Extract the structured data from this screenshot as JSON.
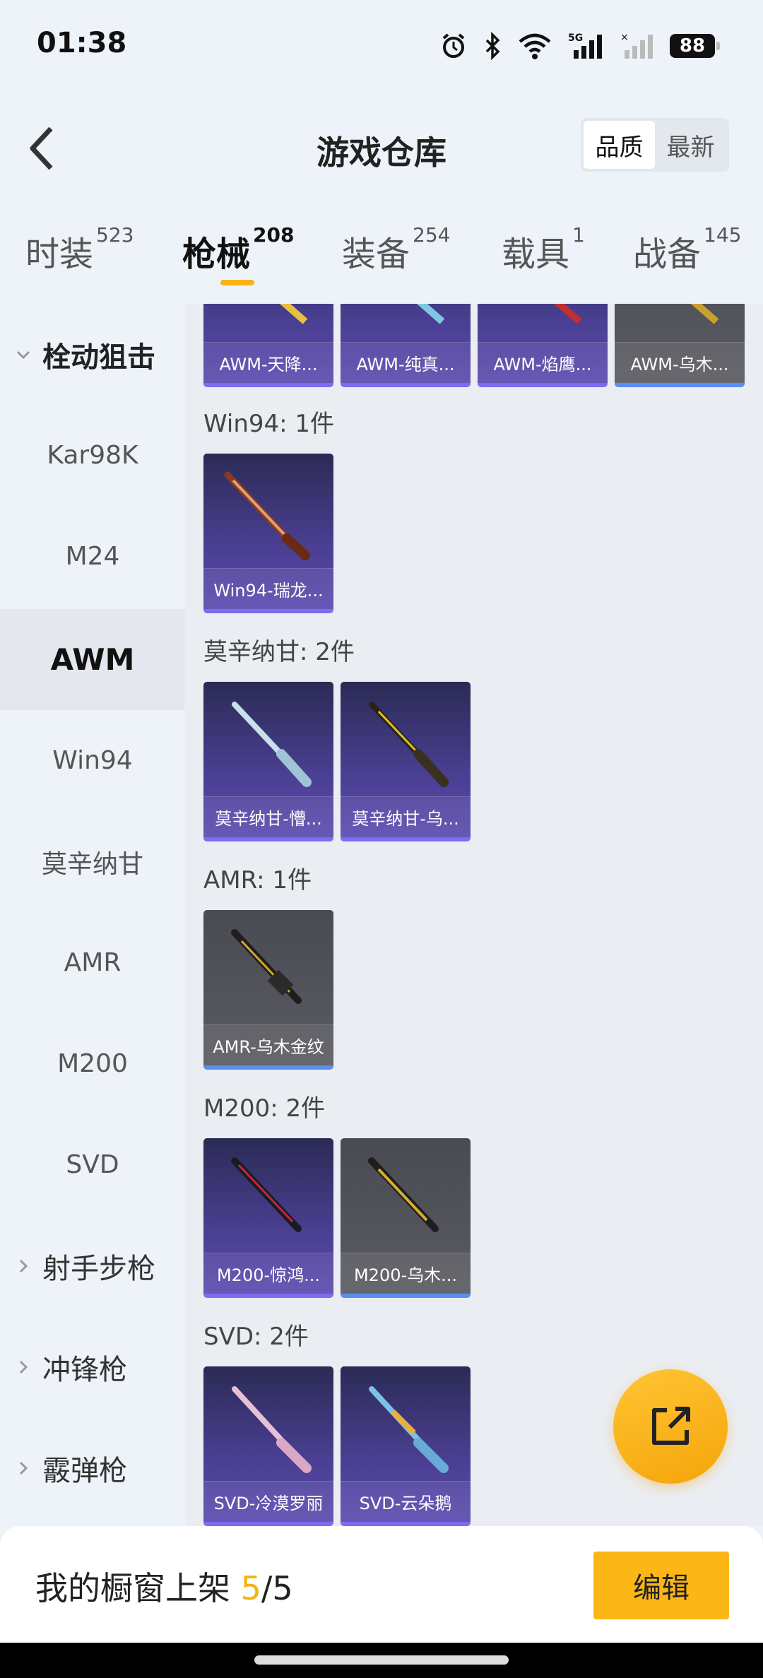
{
  "status_bar": {
    "time": "01:38",
    "battery": "88",
    "network_label": "5G"
  },
  "header": {
    "title": "游戏仓库",
    "sort": [
      "品质",
      "最新"
    ]
  },
  "tabs": [
    {
      "label": "时装",
      "count": "523"
    },
    {
      "label": "枪械",
      "count": "208"
    },
    {
      "label": "装备",
      "count": "254"
    },
    {
      "label": "载具",
      "count": "1"
    },
    {
      "label": "战备",
      "count": "145"
    }
  ],
  "sidebar": {
    "group_open": "栓动狙击",
    "items": [
      "Kar98K",
      "M24",
      "AWM",
      "Win94",
      "莫辛纳甘",
      "AMR",
      "M200",
      "SVD"
    ],
    "groups_closed": [
      "射手步枪",
      "冲锋枪",
      "霰弹枪"
    ]
  },
  "sections": {
    "awm_cards": [
      "AWM-天降...",
      "AWM-纯真...",
      "AWM-焰鹰...",
      "AWM-乌木..."
    ],
    "win94": {
      "title": "Win94: 1件",
      "cards": [
        "Win94-瑞龙..."
      ]
    },
    "mosin": {
      "title": "莫辛纳甘: 2件",
      "cards": [
        "莫辛纳甘-懵...",
        "莫辛纳甘-乌..."
      ]
    },
    "amr": {
      "title": "AMR: 1件",
      "cards": [
        "AMR-乌木金纹"
      ]
    },
    "m200": {
      "title": "M200: 2件",
      "cards": [
        "M200-惊鸿...",
        "M200-乌木..."
      ]
    },
    "svd": {
      "title": "SVD: 2件",
      "cards": [
        "SVD-冷漠罗丽",
        "SVD-云朵鹅"
      ]
    }
  },
  "bottom_bar": {
    "label": "我的橱窗上架 ",
    "count_highlight": "5",
    "count_rest": "/5",
    "edit": "编辑"
  },
  "colors": {
    "accent": "#fcb616",
    "card_purple": "#4a3f92",
    "card_gray": "#55565c"
  }
}
